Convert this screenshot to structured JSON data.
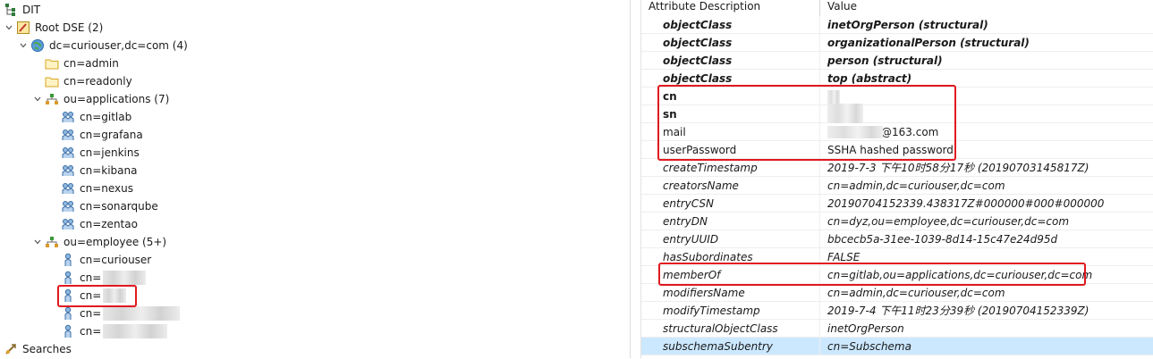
{
  "tree": {
    "root_label": "DIT",
    "root_dse": "Root DSE (2)",
    "domain": "dc=curiouser,dc=com (4)",
    "admin": "cn=admin",
    "readonly": "cn=readonly",
    "applications": "ou=applications (7)",
    "apps": [
      "cn=gitlab",
      "cn=grafana",
      "cn=jenkins",
      "cn=kibana",
      "cn=nexus",
      "cn=sonarqube",
      "cn=zentao"
    ],
    "employee": "ou=employee (5+)",
    "employees": [
      "cn=curiouser",
      "cn=",
      "cn=",
      "cn=",
      "cn="
    ],
    "searches": "Searches"
  },
  "attributes": {
    "header_desc": "Attribute Description",
    "header_value": "Value",
    "rows": [
      {
        "name": "objectClass",
        "value": "inetOrgPerson (structural)"
      },
      {
        "name": "objectClass",
        "value": "organizationalPerson (structural)"
      },
      {
        "name": "objectClass",
        "value": "person (structural)"
      },
      {
        "name": "objectClass",
        "value": "top (abstract)"
      },
      {
        "name": "cn",
        "value": ""
      },
      {
        "name": "sn",
        "value": ""
      },
      {
        "name": "mail",
        "value": "@163.com"
      },
      {
        "name": "userPassword",
        "value": "SSHA hashed password"
      },
      {
        "name": "createTimestamp",
        "value": "2019-7-3 下午10时58分17秒 (20190703145817Z)"
      },
      {
        "name": "creatorsName",
        "value": "cn=admin,dc=curiouser,dc=com"
      },
      {
        "name": "entryCSN",
        "value": "20190704152339.438317Z#000000#000#000000"
      },
      {
        "name": "entryDN",
        "value": "cn=dyz,ou=employee,dc=curiouser,dc=com"
      },
      {
        "name": "entryUUID",
        "value": "bbcecb5a-31ee-1039-8d14-15c47e24d95d"
      },
      {
        "name": "hasSubordinates",
        "value": "FALSE"
      },
      {
        "name": "memberOf",
        "value": "cn=gitlab,ou=applications,dc=curiouser,dc=com"
      },
      {
        "name": "modifiersName",
        "value": "cn=admin,dc=curiouser,dc=com"
      },
      {
        "name": "modifyTimestamp",
        "value": "2019-7-4 下午11时23分39秒 (20190704152339Z)"
      },
      {
        "name": "structuralObjectClass",
        "value": "inetOrgPerson"
      },
      {
        "name": "subschemaSubentry",
        "value": "cn=Subschema"
      }
    ]
  },
  "colors": {
    "highlight": "#e0191f",
    "selected_row": "#cce8ff",
    "folder": "#f2c94c",
    "globe": "#3a7dc9"
  }
}
